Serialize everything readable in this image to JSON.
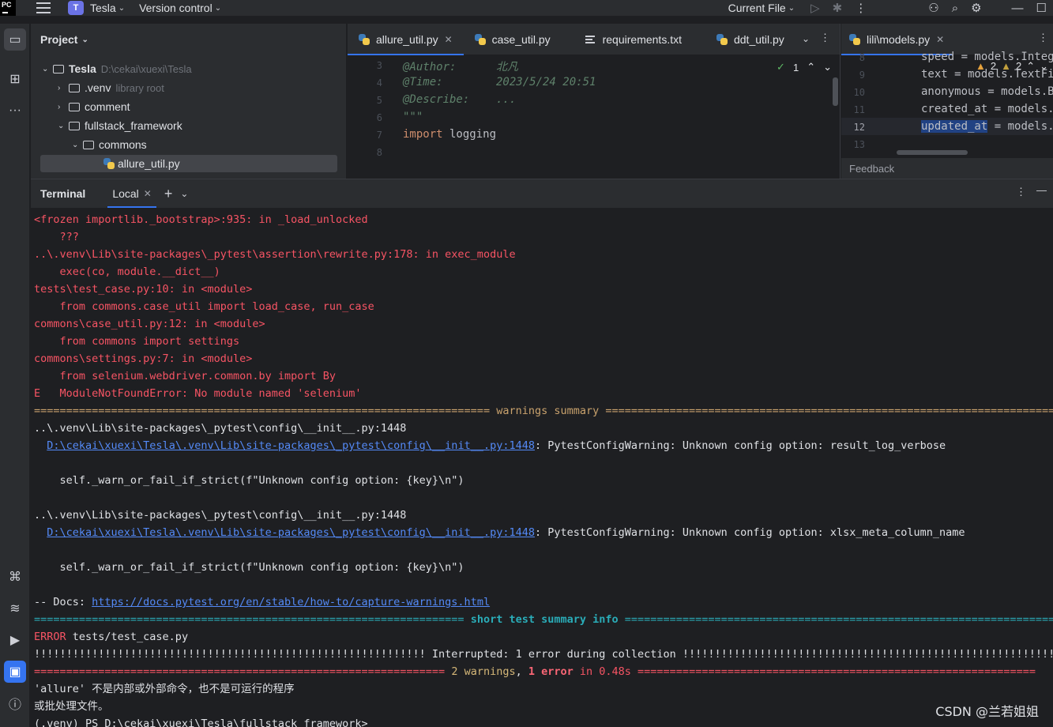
{
  "titlebar": {
    "logo": "PC",
    "project_badge": "T",
    "project_name": "Tesla",
    "vcs": "Version control",
    "run_config": "Current File"
  },
  "project_panel": {
    "title": "Project",
    "rows": [
      {
        "label": "Tesla",
        "hint": "D:\\cekai\\xuexi\\Tesla"
      },
      {
        "label": ".venv",
        "hint": "library root"
      },
      {
        "label": "comment",
        "hint": ""
      },
      {
        "label": "fullstack_framework",
        "hint": ""
      },
      {
        "label": "commons",
        "hint": ""
      },
      {
        "label": "allure_util.py",
        "hint": ""
      }
    ]
  },
  "editor1": {
    "tabs": [
      "allure_util.py",
      "case_util.py",
      "requirements.txt",
      "ddt_util.py"
    ],
    "inspection_count": "1",
    "lines": [
      {
        "num": "3",
        "text": "@Author:      北凡"
      },
      {
        "num": "4",
        "text": "@Time:        2023/5/24 20:51"
      },
      {
        "num": "5",
        "text": "@Describe:    ..."
      },
      {
        "num": "6",
        "text": "\"\"\""
      },
      {
        "num": "7",
        "text_kw": "import",
        "text_rest": " logging"
      },
      {
        "num": "8",
        "text": ""
      }
    ]
  },
  "editor2": {
    "tab": "lili\\models.py",
    "warnings": "2",
    "weak_warnings": "2",
    "lines": [
      {
        "num": "8",
        "text": "speed = models.IntegerF"
      },
      {
        "num": "9",
        "text": "text = models.TextFie"
      },
      {
        "num": "10",
        "text": "anonymous = models.Bo"
      },
      {
        "num": "11",
        "text": "created_at = models.D"
      },
      {
        "num": "12",
        "text_sel": "updated_at",
        "text_rest": " = models.D"
      },
      {
        "num": "13",
        "text": ""
      }
    ],
    "feedback": "Feedback"
  },
  "terminal": {
    "title": "Terminal",
    "tab": "Local",
    "lines": [
      {
        "c": "red",
        "t": "<frozen importlib._bootstrap>:935: in _load_unlocked"
      },
      {
        "c": "red",
        "t": "    ???"
      },
      {
        "c": "red",
        "t": "..\\.venv\\Lib\\site-packages\\_pytest\\assertion\\rewrite.py:178: in exec_module"
      },
      {
        "c": "red",
        "t": "    exec(co, module.__dict__)"
      },
      {
        "c": "red",
        "t": "tests\\test_case.py:10: in <module>"
      },
      {
        "c": "red",
        "t": "    from commons.case_util import load_case, run_case"
      },
      {
        "c": "red",
        "t": "commons\\case_util.py:12: in <module>"
      },
      {
        "c": "red",
        "t": "    from commons import settings"
      },
      {
        "c": "red",
        "t": "commons\\settings.py:7: in <module>"
      },
      {
        "c": "red",
        "t": "    from selenium.webdriver.common.by import By"
      },
      {
        "c": "red",
        "t": "E   ModuleNotFoundError: No module named 'selenium'"
      },
      {
        "c": "yellow",
        "t": "======================================================================= warnings summary ======================================================================="
      },
      {
        "c": "",
        "t": "..\\.venv\\Lib\\site-packages\\_pytest\\config\\__init__.py:1448"
      },
      {
        "c": "link2",
        "link": "D:\\cekai\\xuexi\\Tesla\\.venv\\Lib\\site-packages\\_pytest\\config\\__init__.py:1448",
        "t": ": PytestConfigWarning: Unknown config option: result_log_verbose"
      },
      {
        "c": "",
        "t": ""
      },
      {
        "c": "",
        "t": "    self._warn_or_fail_if_strict(f\"Unknown config option: {key}\\n\")"
      },
      {
        "c": "",
        "t": ""
      },
      {
        "c": "",
        "t": "..\\.venv\\Lib\\site-packages\\_pytest\\config\\__init__.py:1448"
      },
      {
        "c": "link2",
        "link": "D:\\cekai\\xuexi\\Tesla\\.venv\\Lib\\site-packages\\_pytest\\config\\__init__.py:1448",
        "t": ": PytestConfigWarning: Unknown config option: xlsx_meta_column_name"
      },
      {
        "c": "",
        "t": ""
      },
      {
        "c": "",
        "t": "    self._warn_or_fail_if_strict(f\"Unknown config option: {key}\\n\")"
      },
      {
        "c": "",
        "t": ""
      },
      {
        "c": "docs",
        "pre": "-- Docs: ",
        "link": "https://docs.pytest.org/en/stable/how-to/capture-warnings.html"
      },
      {
        "c": "summary",
        "left": "=================================================================== ",
        "mid": "short test summary info",
        "right": " ======================================================================"
      },
      {
        "c": "error",
        "pre": "ERROR",
        "t": " tests/test_case.py"
      },
      {
        "c": "",
        "t": "!!!!!!!!!!!!!!!!!!!!!!!!!!!!!!!!!!!!!!!!!!!!!!!!!!!!!!!!!!!!! Interrupted: 1 error during collection !!!!!!!!!!!!!!!!!!!!!!!!!!!!!!!!!!!!!!!!!!!!!!!!!!!!!!!!!!!!!"
      },
      {
        "c": "final",
        "left": "================================================================ ",
        "w": "2 warnings",
        "sep": ", ",
        "e": "1 error",
        "right": " in 0.48s =============================================================="
      },
      {
        "c": "",
        "t": "'allure' 不是内部或外部命令，也不是可运行的程序"
      },
      {
        "c": "",
        "t": "或批处理文件。"
      },
      {
        "c": "",
        "t": "(.venv) PS D:\\cekai\\xuexi\\Tesla\\fullstack_framework>"
      }
    ]
  },
  "watermark": "CSDN @兰若姐姐"
}
